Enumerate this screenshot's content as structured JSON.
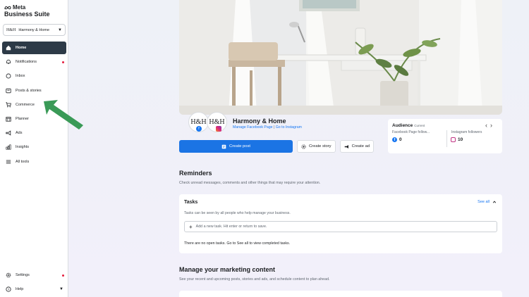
{
  "brand": {
    "meta": "Meta",
    "suite": "Business Suite"
  },
  "account": {
    "logo": "H&H",
    "name": "Harmony & Home"
  },
  "nav": [
    {
      "label": "Home",
      "icon": "home-icon",
      "active": true
    },
    {
      "label": "Notifications",
      "icon": "bell-icon",
      "dot": true
    },
    {
      "label": "Inbox",
      "icon": "chat-icon"
    },
    {
      "label": "Posts & stories",
      "icon": "posts-icon"
    },
    {
      "label": "Commerce",
      "icon": "cart-icon"
    },
    {
      "label": "Planner",
      "icon": "calendar-icon"
    },
    {
      "label": "Ads",
      "icon": "megaphone-icon"
    },
    {
      "label": "Insights",
      "icon": "bar-chart-icon"
    },
    {
      "label": "All tools",
      "icon": "menu-icon"
    }
  ],
  "bottom_nav": [
    {
      "label": "Settings",
      "icon": "gear-icon",
      "dot": true
    },
    {
      "label": "Help",
      "icon": "help-icon"
    }
  ],
  "profile": {
    "name": "Harmony & Home",
    "avatar_text": "H&H",
    "link_fb": "Manage Facebook Page",
    "link_sep": " | ",
    "link_ig": "Go to Instagram"
  },
  "audience": {
    "title": "Audience",
    "subtitle": "Current",
    "fb_label": "Facebook Page follow...",
    "ig_label": "Instagram followers",
    "fb_value": "0",
    "ig_value": "10"
  },
  "actions": {
    "create_post": "Create post",
    "create_story": "Create story",
    "create_ad": "Create ad"
  },
  "reminders": {
    "title": "Reminders",
    "subtitle": "Check unread messages, comments and other things that may require your attention."
  },
  "tasks": {
    "title": "Tasks",
    "see_all": "See all",
    "subtitle": "Tasks can be seen by all people who help manage your business.",
    "placeholder": "Add a new task. Hit enter or return to save.",
    "empty": "There are no open tasks. Go to See all to view completed tasks."
  },
  "marketing": {
    "title": "Manage your marketing content",
    "subtitle": "See your recent and upcoming posts, stories and ads, and schedule content to plan ahead."
  },
  "colors": {
    "accent": "#1b74e4",
    "active_nav": "#2d3a47",
    "arrow": "#3a9a57",
    "dot": "#e41e3f"
  }
}
